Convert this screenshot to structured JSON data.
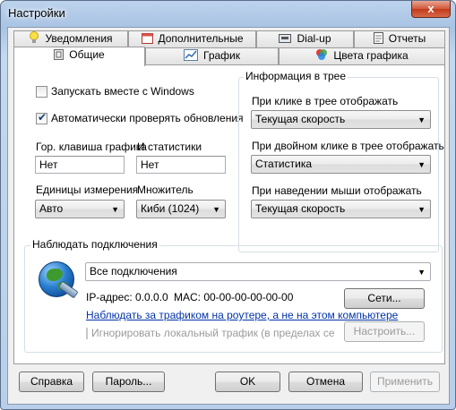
{
  "window": {
    "title": "Настройки",
    "close_glyph": "x"
  },
  "tabs_back": [
    {
      "label": "Уведомления",
      "icon": "bulb-icon"
    },
    {
      "label": "Дополнительные",
      "icon": "calendar-icon"
    },
    {
      "label": "Dial-up",
      "icon": "dialup-icon"
    },
    {
      "label": "Отчеты",
      "icon": "document-icon"
    }
  ],
  "tabs_front": [
    {
      "label": "Общие",
      "icon": "general-icon",
      "active": true
    },
    {
      "label": "График",
      "icon": "chart-icon"
    },
    {
      "label": "Цвета графика",
      "icon": "palette-icon"
    }
  ],
  "general": {
    "run_with_windows": {
      "label": "Запускать вместе с Windows",
      "checked": false
    },
    "auto_update": {
      "label": "Автоматически проверять обновления",
      "checked": true
    },
    "graph_hotkey_label": "Гор. клавиша графика",
    "graph_hotkey_value": "Нет",
    "stats_hotkey_label": "И статистики",
    "stats_hotkey_value": "Нет",
    "units_label": "Единицы измерения",
    "units_value": "Авто",
    "multiplier_label": "Множитель",
    "multiplier_value": "Киби (1024)"
  },
  "tray": {
    "title": "Информация в трее",
    "click_label": "При клике в трее отображать",
    "click_value": "Текущая скорость",
    "dblclick_label": "При двойном клике в трее отображать",
    "dblclick_value": "Статистика",
    "hover_label": "При наведении мыши отображать",
    "hover_value": "Текущая скорость"
  },
  "connections": {
    "title": "Наблюдать подключения",
    "selected": "Все подключения",
    "ip_text": "IP-адрес: 0.0.0.0",
    "mac_text": "MAC: 00-00-00-00-00-00",
    "networks_button": "Сети...",
    "router_link": "Наблюдать за трафиком на роутере, а не на этом компьютере",
    "ignore_local": {
      "label": "Игнорировать локальный трафик (в пределах сети)",
      "checked": false
    },
    "configure_button": "Настроить..."
  },
  "footer": {
    "help": "Справка",
    "password": "Пароль...",
    "ok": "OK",
    "cancel": "Отмена",
    "apply": "Применить"
  }
}
